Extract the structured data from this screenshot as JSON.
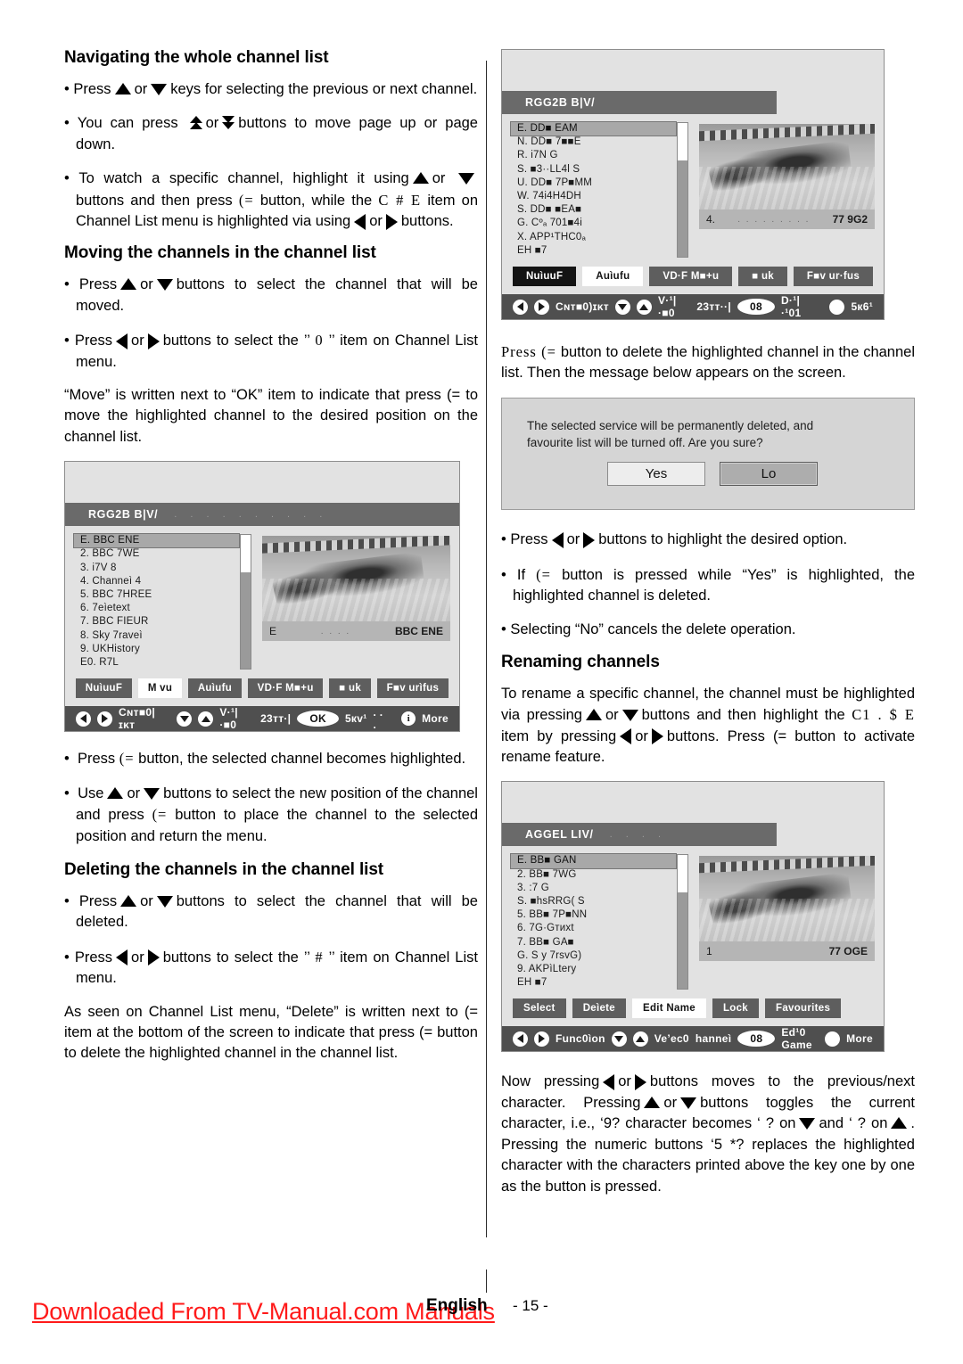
{
  "left_column": {
    "heading_1": "Navigating the whole channel list",
    "bullets_1": [
      {
        "pre": "Press",
        "icons": [
          "up-arrow",
          "down-arrow"
        ],
        "post": "keys for selecting the previous or next channel."
      },
      {
        "pre": "You can press",
        "icons": [
          "page-up-arrow",
          "page-down-arrow"
        ],
        "post": "buttons to move page up or page down."
      }
    ],
    "bullet_watch_p1": "To watch a specific channel, highlight it using",
    "bullet_watch_p2": "buttons and then press",
    "bullet_watch_ok": "(=",
    "bullet_watch_p3": "button, while the",
    "bullet_watch_token": "C # E",
    "bullet_watch_p4": "item on Channel List menu is highlighted via using",
    "bullet_watch_p5": "buttons.",
    "heading_2": "Moving the channels in the channel list",
    "bullet_move_1_pre": "Press",
    "bullet_move_1_post": "buttons to select the channel that will be moved.",
    "bullet_move_2_pre": "Press",
    "bullet_move_2_mid": "buttons to select the ’’",
    "bullet_move_2_token": "0",
    "bullet_move_2_post": "’’ item on Channel List menu.",
    "para_move": "“Move” is written next to “OK” item to indicate that press (=  to move the highlighted channel to the desired position on the channel list.",
    "bullet_move_3_pre": "Press",
    "bullet_move_3_ok": "(=",
    "bullet_move_3_post": "button, the selected channel becomes highlighted.",
    "bullet_move_4_pre": "Use",
    "bullet_move_4_mid": "buttons to select the new position of the channel and press",
    "bullet_move_4_ok": "(=",
    "bullet_move_4_post": "button to place the channel  to the selected position and return the menu.",
    "heading_3": "Deleting the channels in the channel list",
    "bullet_del_1_pre": "Press",
    "bullet_del_1_post": "buttons to select the channel that will be deleted.",
    "bullet_del_2_pre": "Press",
    "bullet_del_2_mid": "buttons to select the ’’",
    "bullet_del_2_token": "#",
    "bullet_del_2_post": "’’ item on Channel List menu.",
    "para_delete": "As seen on Channel List menu, “Delete” is written next to (=  item at the bottom of the screen to indicate that press (=  button to delete the highlighted channel in the channel list."
  },
  "right_column": {
    "para_delete_intro_1": "Press (=",
    "para_delete_intro_2": "button to delete the highlighted channel in the channel list. Then the message below appears on the screen.",
    "bullet_hl_pre": "Press",
    "bullet_hl_post": "buttons to highlight the desired option.",
    "bullet_if_pre": "If",
    "bullet_if_ok": "(=",
    "bullet_if_post": "button is pressed while “Yes” is highlighted, the highlighted channel is deleted.",
    "bullet_no": "Selecting “No” cancels the delete operation.",
    "heading_rename": "Renaming channels",
    "para_rename_1": "To rename a specific channel, the channel must be highlighted via pressing",
    "para_rename_2": "buttons and then highlight the",
    "para_rename_token": "C1   . $ E",
    "para_rename_3": "item by pressing",
    "para_rename_4": "buttons. Press (=  button to activate rename feature.",
    "para_now_1": "Now  pressing",
    "para_now_2": "buttons moves to the previous/next character. Pressing",
    "para_now_3": "buttons toggles the current character, i.e., ‘9? character becomes ‘ ? on",
    "para_now_4": "and ‘ ? on",
    "para_now_5": ". Pressing the numeric buttons ‘5  *? replaces the highlighted character with the characters printed above the key one by one as the button is pressed."
  },
  "dialog": {
    "message_line_1": "The selected service will be permanently deleted, and",
    "message_line_2": "favourite list will be turned off. Are you sure?",
    "yes_label": "Yes",
    "no_label": "Lo"
  },
  "tv_top_right": {
    "title": "RGG2B B|V/",
    "title_dots": ". .    .     . . . .   .  . .",
    "channels": [
      "E. DD■ EAM",
      "N. DD■ 7■■E",
      "R. i7N G",
      "S. ■3··LL4l S",
      "U. DD■ 7P■MM",
      "W. 74i4H4DH",
      "S. DD■ ■EA■",
      "G. Cºₐ 701■4i",
      "X. APP¹THC0ₐ",
      "EH ■7"
    ],
    "selected_index": 0,
    "preview_caption_left": "4.",
    "preview_caption_dots": ". . . . . . . . .",
    "preview_caption_right": "77  9G2",
    "buttons": [
      {
        "label": "NuìuuF",
        "state": "dark"
      },
      {
        "label": "Auìufu",
        "state": "active"
      },
      {
        "label": "VD·F M■+u",
        "state": "plain"
      },
      {
        "label": "■ uk",
        "state": "plain"
      },
      {
        "label": "F■v ur·fus",
        "state": "plain"
      }
    ],
    "status": {
      "left_label": "Cɴᴛ■0)ɪᴋᴛ",
      "mid_label": "V·¹|·■0",
      "select_label": "23ᴛᴛ··|",
      "pill": "08",
      "right_label": "D·¹|·¹01",
      "far_right_label": "5к6¹"
    }
  },
  "tv_left": {
    "title": "RGG2B B|V/",
    "title_dots": ". .    .     . . . .   .  . .",
    "channels": [
      "E. BBC ENE",
      "2. BBC 7WE",
      "3. i7V 8",
      "4. Channeì 4",
      "5. BBC 7HREE",
      "6. 7eìetext",
      "7. BBC FIEUR",
      "8. Sky 7raveì",
      "9. UKHistory",
      "E0. R7L"
    ],
    "selected_index": 0,
    "preview_caption_left": "E",
    "preview_caption_dots": ". .  . .",
    "preview_caption_right": "BBC ENE",
    "buttons": [
      {
        "label": "NuìuuF",
        "state": "plain"
      },
      {
        "label": "M  vu",
        "state": "active"
      },
      {
        "label": "Auìufu",
        "state": "plain"
      },
      {
        "label": "VD·F M■+u",
        "state": "plain"
      },
      {
        "label": "■ uk",
        "state": "plain"
      },
      {
        "label": "F■v urìfus",
        "state": "plain"
      }
    ],
    "status": {
      "left_label": "Cɴᴛ■0|ɪᴋᴛ",
      "mid_label": "V·¹|·■0",
      "select_label": "23ᴛᴛ·|",
      "pill": "OK",
      "right_label": "5кᴠ¹",
      "right_dots": ". . .",
      "more_label": "More"
    }
  },
  "tv_bottom_right": {
    "title": "AGGEL LIV/",
    "title_dots": ".          .        .    .",
    "channels": [
      "E. BB■ GAN",
      "2. BB■ 7WG",
      "3. :7  G",
      "S. ■hsRRG( S",
      "5. BB■ 7P■NN",
      "6. 7G·Gᴛᴎxt",
      "7. BB■  GA■",
      "G. S  y 7rsvG)",
      "9. AKPìLtery",
      "EH ■7"
    ],
    "selected_index": 0,
    "preview_caption_left": "1",
    "preview_caption_dots": "",
    "preview_caption_right": "77  OGE",
    "buttons": [
      {
        "label": "Select",
        "state": "plain"
      },
      {
        "label": "Deìete",
        "state": "plain"
      },
      {
        "label": "Edit Name",
        "state": "active"
      },
      {
        "label": "Lock",
        "state": "plain"
      },
      {
        "label": "Favourites",
        "state": "plain"
      }
    ],
    "status": {
      "left_label": "Func0ìon",
      "mid_label": "Veʼec0",
      "select_label": "hanneì",
      "pill": "08",
      "right_label": "Ed¹0 Game",
      "more_label": "More"
    }
  },
  "footer": {
    "language": "English",
    "page_number": "- 15 -",
    "watermark": "Downloaded From TV-Manual.com Manuals"
  },
  "colors": {
    "watermark": "#ff1a1a",
    "tv_bg": "#e2e2e2",
    "tv_titlebar": "#6a6a6a",
    "tv_statusbar": "#4f4f4f",
    "tv_button": "#5e5e5e",
    "tv_selected_row": "#a8a8a8",
    "dialog_bg": "#d5d5d5"
  }
}
